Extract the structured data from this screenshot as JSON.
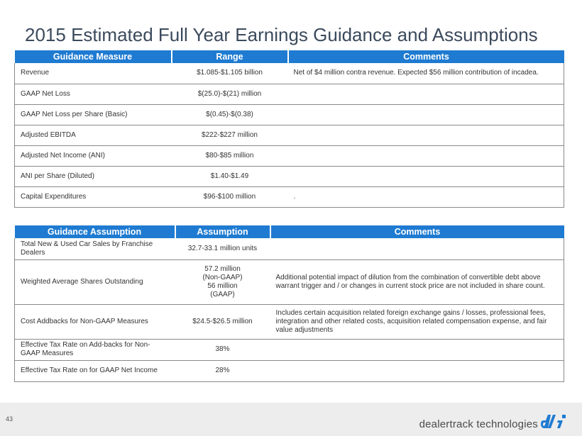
{
  "title": "2015 Estimated Full Year Earnings Guidance and Assumptions",
  "guidance_table": {
    "headers": [
      "Guidance Measure",
      "Range",
      "Comments"
    ],
    "rows": [
      {
        "measure": "Revenue",
        "range": "$1.085-$1.105  billion",
        "comment": "Net  of $4 million  contra revenue. Expected  $56 million   contribution  of incadea."
      },
      {
        "measure": "GAAP Net Loss",
        "range": "$(25.0)-$(21)  million",
        "comment": ""
      },
      {
        "measure": "GAAP Net Loss per Share (Basic)",
        "range": "$(0.45)-$(0.38)",
        "comment": ""
      },
      {
        "measure": "Adjusted EBITDA",
        "range": "$222-$227  million",
        "comment": ""
      },
      {
        "measure": "Adjusted Net Income  (ANI)",
        "range": "$80-$85  million",
        "comment": ""
      },
      {
        "measure": "ANI per Share (Diluted)",
        "range": "$1.40-$1.49",
        "comment": ""
      },
      {
        "measure": "Capital  Expenditures",
        "range": "$96-$100  million",
        "comment": "."
      }
    ]
  },
  "assumption_table": {
    "headers": [
      "Guidance Assumption",
      "Assumption",
      "Comments"
    ],
    "rows": [
      {
        "assumption": "Total New & Used Car Sales by Franchise Dealers",
        "value": "32.7-33.1  million  units",
        "comment": ""
      },
      {
        "assumption": "Weighted  Average Shares Outstanding",
        "value_lines": [
          "57.2 million",
          "(Non-GAAP)",
          "56 million",
          "(GAAP)"
        ],
        "comment": "Additional  potential  impact  of dilution  from the combination   of convertible debt above  warrant trigger and / or changes in current stock price are not included in share count."
      },
      {
        "assumption": "Cost Addbacks for Non-GAAP  Measures",
        "value": "$24.5-$26.5  million",
        "comment": "Includes  certain  acquisition  related  foreign exchange gains / losses, professional fees, integration  and other related costs, acquisition  related compensation   expense,  and fair value  adjustments"
      },
      {
        "assumption": "Effective Tax Rate on Add-backs for Non-GAAP  Measures",
        "value": "38%",
        "comment": ""
      },
      {
        "assumption": "Effective Tax Rate on for GAAP Net Income",
        "value": "28%",
        "comment": ""
      }
    ]
  },
  "footer": {
    "page_number": "43",
    "brand": "dealertrack technologies",
    "brand_color": "#1f7bd1",
    "header_color": "#1f7bd1"
  }
}
